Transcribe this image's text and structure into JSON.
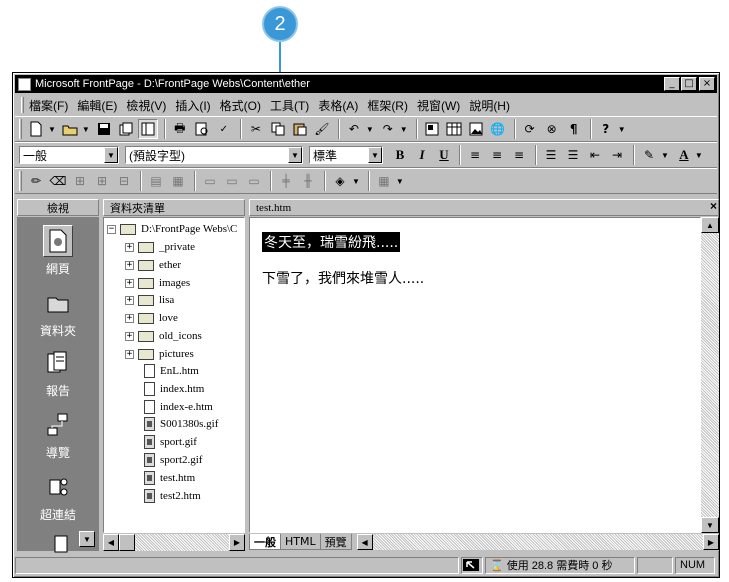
{
  "callout": {
    "number": "2"
  },
  "window": {
    "title": "Microsoft FrontPage - D:\\FrontPage Webs\\Content\\ether",
    "min": "_",
    "max": "□",
    "close": "×"
  },
  "menu": [
    "檔案(F)",
    "編輯(E)",
    "檢視(V)",
    "插入(I)",
    "格式(O)",
    "工具(T)",
    "表格(A)",
    "框架(R)",
    "視窗(W)",
    "說明(H)"
  ],
  "format_toolbar": {
    "style": "一般",
    "font": "(預設字型)",
    "size": "標準",
    "bold": "B",
    "italic": "I",
    "underline": "U",
    "font_color": "A"
  },
  "views_panel": {
    "title": "檢視",
    "items": [
      "網頁",
      "資料夾",
      "報告",
      "導覽",
      "超連結"
    ]
  },
  "folder_list": {
    "title": "資料夾清單",
    "root": "D:\\FrontPage Webs\\C",
    "folders": [
      "_private",
      "ether",
      "images",
      "lisa",
      "love",
      "old_icons",
      "pictures"
    ],
    "files": [
      {
        "name": "EnL.htm",
        "type": "html"
      },
      {
        "name": "index.htm",
        "type": "html"
      },
      {
        "name": "index-e.htm",
        "type": "html"
      },
      {
        "name": "S001380s.gif",
        "type": "image"
      },
      {
        "name": "sport.gif",
        "type": "image"
      },
      {
        "name": "sport2.gif",
        "type": "image"
      },
      {
        "name": "test.htm",
        "type": "page"
      },
      {
        "name": "test2.htm",
        "type": "page"
      }
    ]
  },
  "editor": {
    "doc_title": "test.htm",
    "close": "×",
    "line1": "冬天至，瑞雪紛飛.....",
    "line2": "下雪了，我們來堆雪人.....",
    "tabs": [
      "一般",
      "HTML",
      "預覽"
    ]
  },
  "status": {
    "download": "使用 28.8 需費時 0 秒",
    "num": "NUM"
  }
}
